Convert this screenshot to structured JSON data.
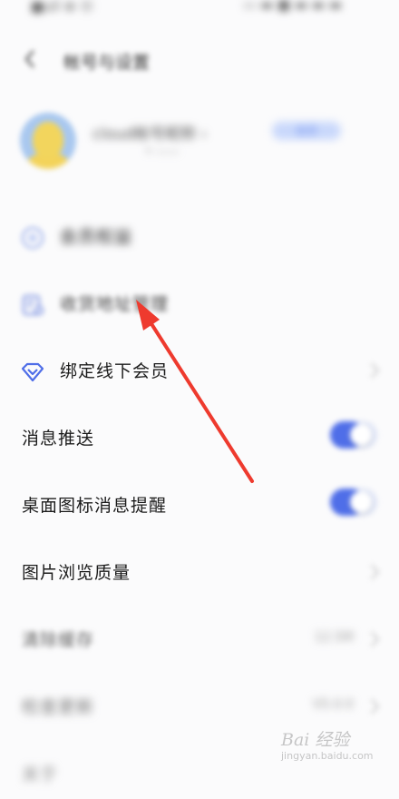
{
  "status_bar": {
    "left": "■ull ⊕ ⓦ",
    "right": "▭ ▬ ■ ▬ ▬ ▬"
  },
  "header": {
    "title": "帐号与设置"
  },
  "profile": {
    "username": "cloud帐号昵称 ›",
    "subtitle": "• ——",
    "badge": "会员"
  },
  "rows": {
    "blurred_service": {
      "label": "会员权益"
    },
    "address": {
      "label": "收货地址管理"
    },
    "bind_member": {
      "label": "绑定线下会员"
    },
    "push": {
      "label": "消息推送",
      "enabled": true
    },
    "desktop_badge": {
      "label": "桌面图标消息提醒",
      "enabled": true
    },
    "image_quality": {
      "label": "图片浏览质量"
    },
    "clear_cache": {
      "label": "清除缓存",
      "value": "12.5M"
    },
    "cache_status": {
      "label": "检查更新",
      "value": "V5.0.0"
    },
    "about": {
      "label": "关于"
    }
  },
  "watermark": {
    "logo": "Bai 经验",
    "sub": "jingyan.baidu.com"
  },
  "colors": {
    "accent": "#4f6ee8",
    "annotation_arrow": "#ee3a2e"
  }
}
